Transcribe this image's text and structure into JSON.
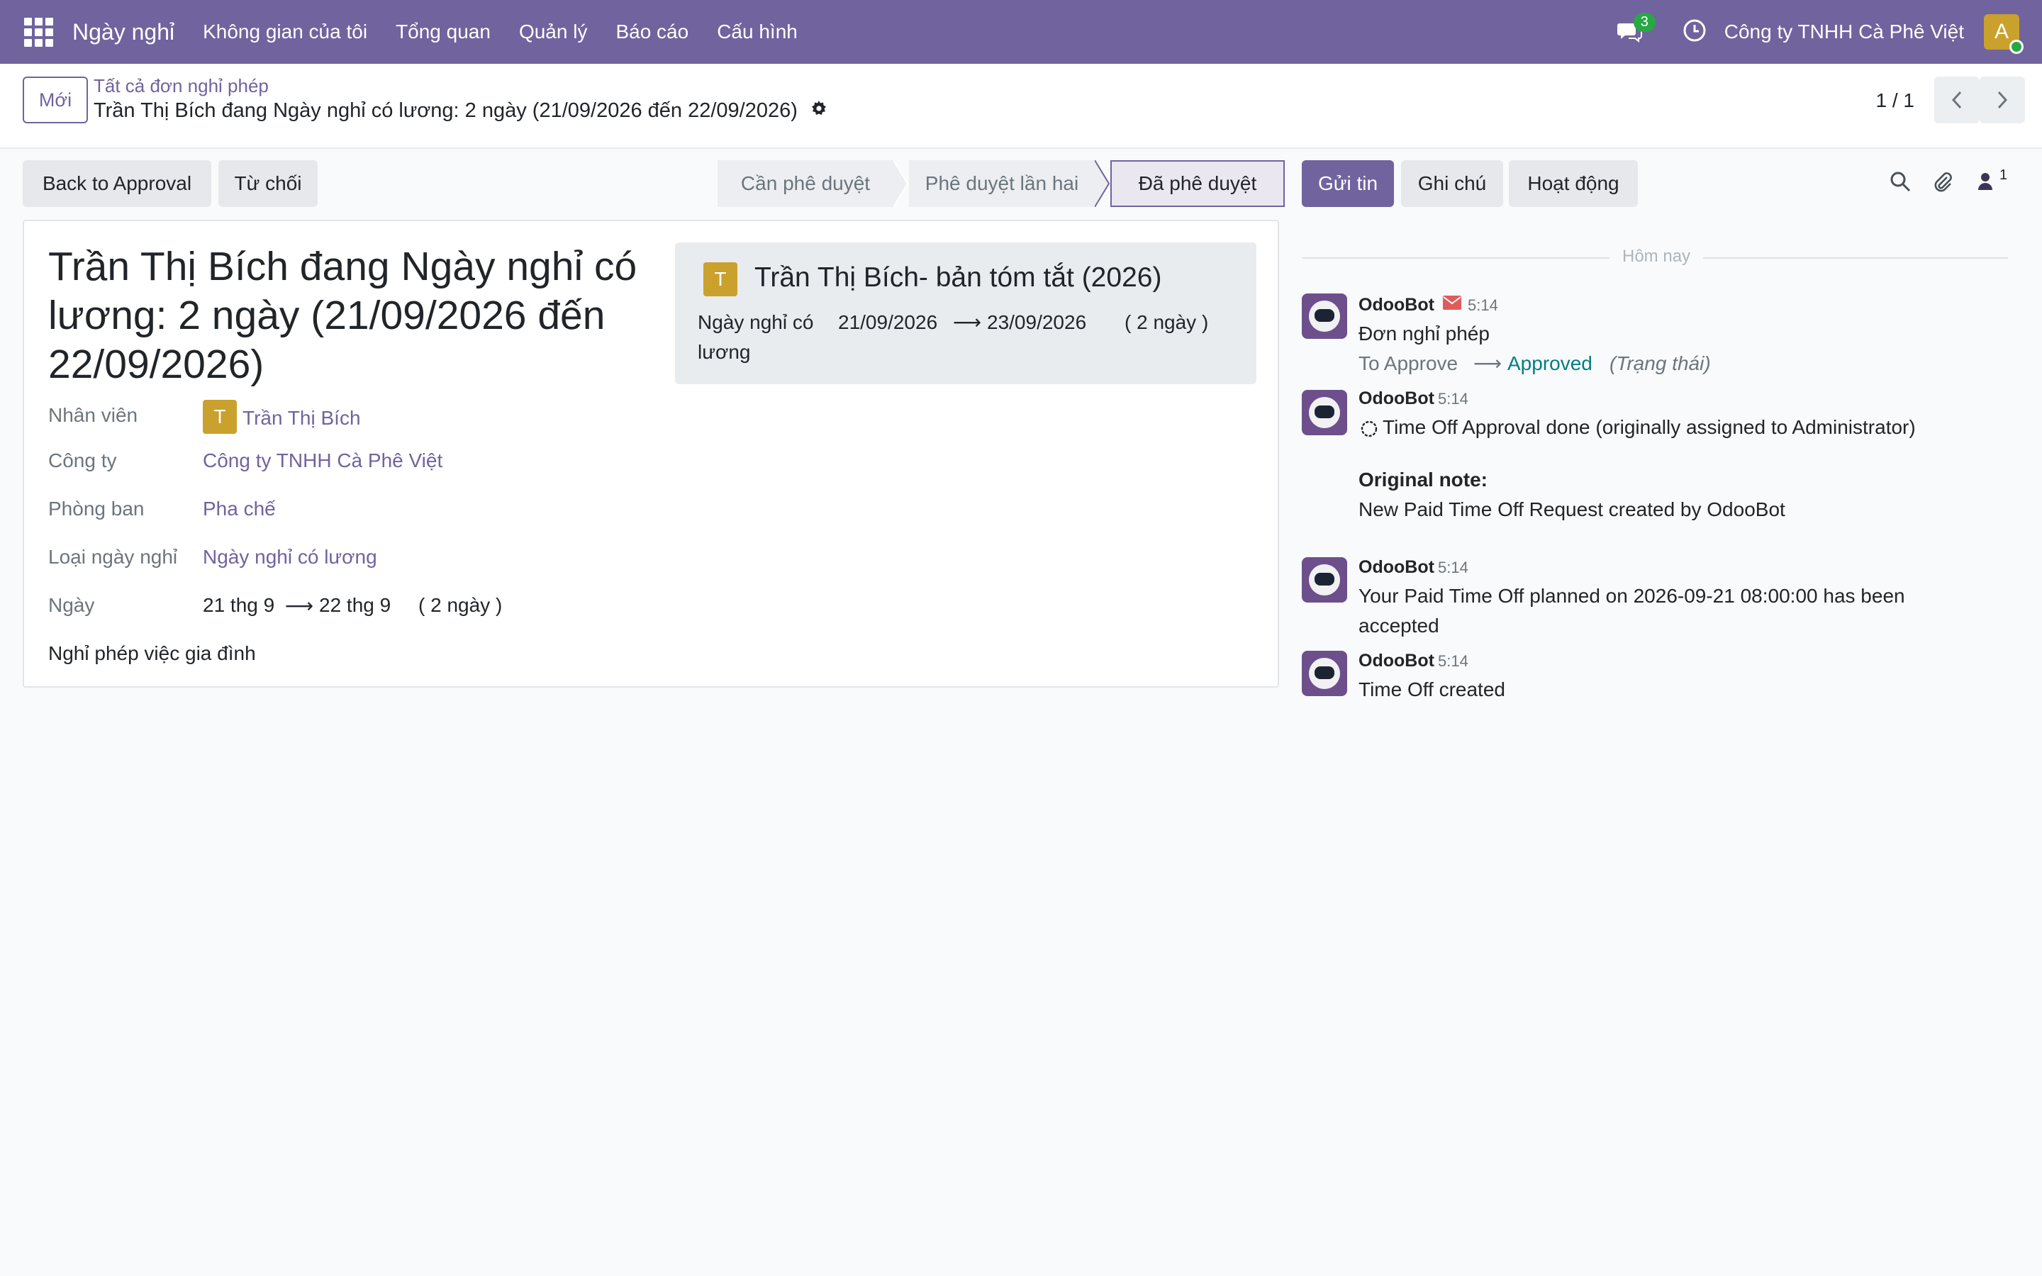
{
  "topbar": {
    "app_name": "Ngày nghỉ",
    "menus": [
      "Không gian của tôi",
      "Tổng quan",
      "Quản lý",
      "Báo cáo",
      "Cấu hình"
    ],
    "chat_count": "3",
    "company": "Công ty TNHH Cà Phê Việt",
    "avatar_letter": "A"
  },
  "control": {
    "new_label": "Mới",
    "breadcrumb_parent": "Tất cả đơn nghỉ phép",
    "breadcrumb_current": "Trần Thị Bích đang Ngày nghỉ có lương: 2 ngày (21/09/2026 đến 22/09/2026)",
    "pager": "1 / 1"
  },
  "actions": {
    "back_to_approval": "Back to Approval",
    "refuse": "Từ chối"
  },
  "stages": [
    "Cần phê duyệt",
    "Phê duyệt lần hai",
    "Đã phê duyệt"
  ],
  "form": {
    "title": "Trần Thị Bích đang Ngày nghỉ có lương: 2 ngày (21/09/2026 đến 22/09/2026)",
    "summary": {
      "avatar_letter": "T",
      "title": "Trần Thị Bích- bản tóm tắt (2026)",
      "type": "Ngày nghỉ có lương",
      "date_from": "21/09/2026",
      "arrow": "⟶",
      "date_to": "23/09/2026",
      "duration": "( 2 ngày )"
    },
    "employee_label": "Nhân viên",
    "employee_letter": "T",
    "employee": "Trần Thị Bích",
    "company_label": "Công ty",
    "company": "Công ty TNHH Cà Phê Việt",
    "department_label": "Phòng ban",
    "department": "Pha chế",
    "leave_type_label": "Loại ngày nghỉ",
    "leave_type": "Ngày nghỉ có lương",
    "date_label": "Ngày",
    "date_from": "21 thg 9",
    "arrow": "⟶",
    "date_to": "22 thg 9",
    "duration": "( 2 ngày )",
    "description": "Nghỉ phép việc gia đình"
  },
  "chatter": {
    "send_message": "Gửi tin",
    "log_note": "Ghi chú",
    "activities": "Hoạt động",
    "followers_count": "1",
    "today": "Hôm nay",
    "messages": [
      {
        "author": "OdooBot",
        "time": "5:14",
        "line1": "Đơn nghỉ phép",
        "from": "To Approve",
        "arrow": "⟶",
        "to": "Approved",
        "field": "(Trạng thái)"
      },
      {
        "author": "OdooBot",
        "time": "5:14",
        "line1": "Time Off Approval done (originally assigned to Administrator)",
        "note_label": "Original note:",
        "note": "New Paid Time Off Request created by OdooBot"
      },
      {
        "author": "OdooBot",
        "time": "5:14",
        "line1": "Your Paid Time Off planned on 2026-09-21 08:00:00 has been accepted"
      },
      {
        "author": "OdooBot",
        "time": "5:14",
        "line1": "Time Off created"
      }
    ]
  },
  "colors": {
    "brand": "#71639e",
    "accent_teal": "#017e84",
    "badge_green": "#28a745",
    "avatar_gold": "#c9a12c"
  }
}
